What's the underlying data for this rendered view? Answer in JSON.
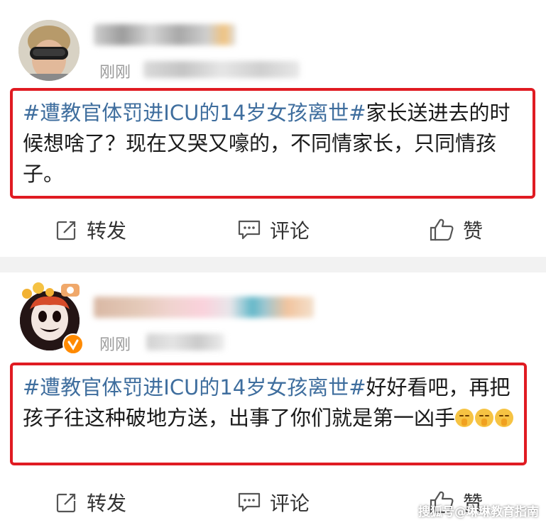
{
  "posts": [
    {
      "time": "刚刚",
      "hashtag": "#遭教官体罚进ICU的14岁女孩离世#",
      "text": "家长送进去的时候想啥了？现在又哭又嚎的，不同情家长，只同情孩子。",
      "actions": {
        "repost": "转发",
        "comment": "评论",
        "like": "赞"
      }
    },
    {
      "time": "刚刚",
      "hashtag": "#遭教官体罚进ICU的14岁女孩离世#",
      "text": "好好看吧，再把孩子往这种破地方送，出事了你们就是第一凶手",
      "emojis": [
        "shush-emoji",
        "shush-emoji",
        "shush-emoji"
      ],
      "actions": {
        "repost": "转发",
        "comment": "评论",
        "like": "赞"
      }
    }
  ],
  "watermark": "搜狐号@琳琳教育指南",
  "colors": {
    "hashtag": "#3f6e9e",
    "highlight_border": "#e01b22",
    "separator": "#f2f2f2"
  }
}
